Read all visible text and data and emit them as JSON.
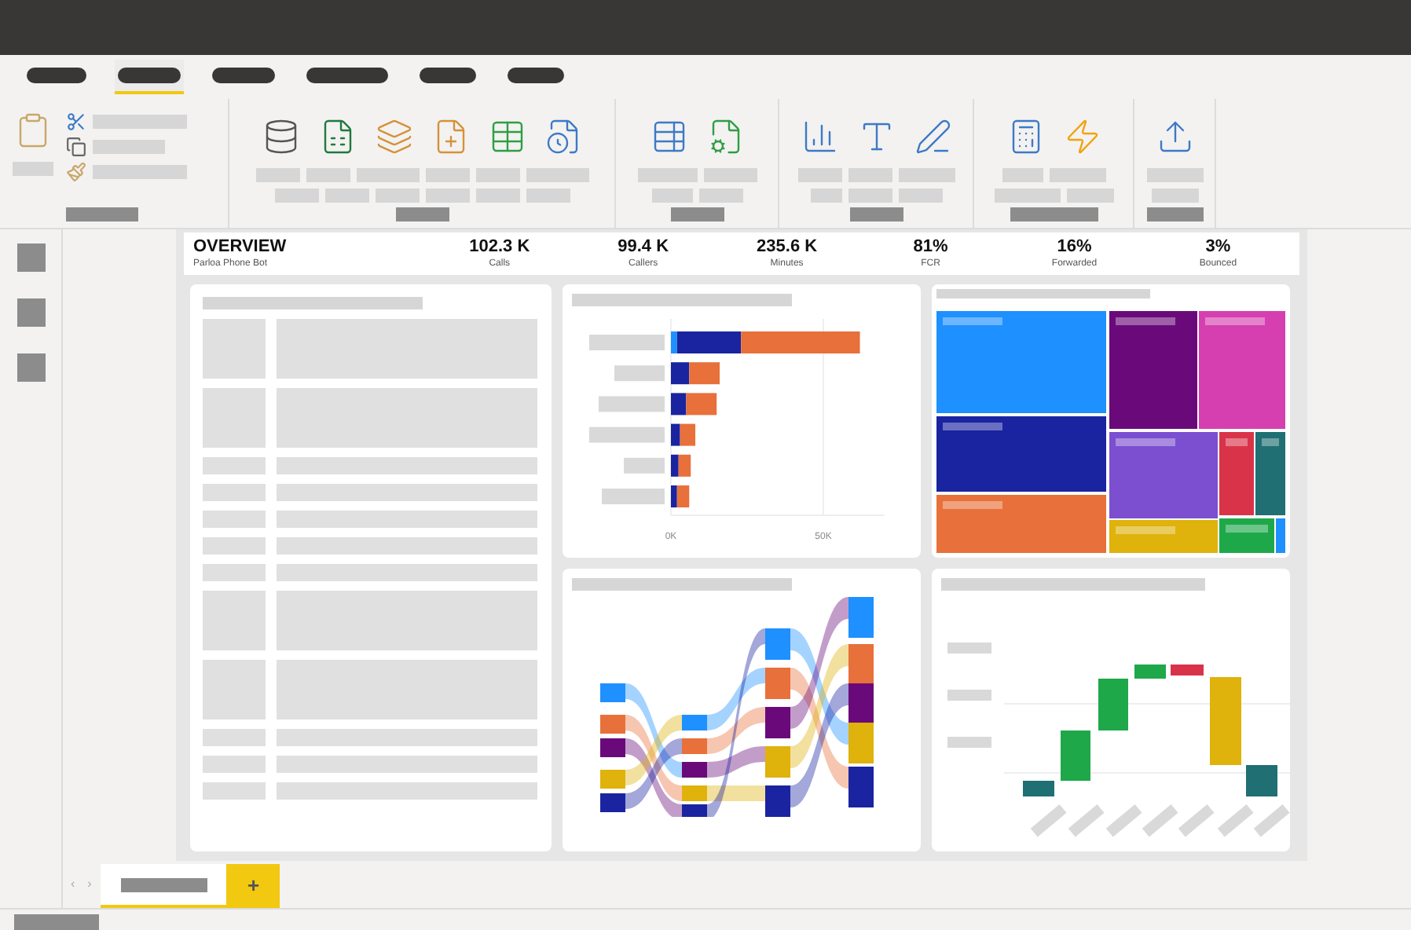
{
  "ribbon_tabs": [
    {
      "selected": false
    },
    {
      "selected": true
    },
    {
      "selected": false
    },
    {
      "selected": false
    },
    {
      "selected": false
    },
    {
      "selected": false
    }
  ],
  "report": {
    "title": "OVERVIEW",
    "subtitle": "Parloa Phone Bot",
    "kpis": [
      {
        "value": "102.3 K",
        "label": "Calls"
      },
      {
        "value": "99.4 K",
        "label": "Callers"
      },
      {
        "value": "235.6 K",
        "label": "Minutes"
      },
      {
        "value": "81%",
        "label": "FCR"
      },
      {
        "value": "16%",
        "label": "Forwarded"
      },
      {
        "value": "3%",
        "label": "Bounced"
      }
    ]
  },
  "bar_chart": {
    "chart_data": {
      "type": "bar",
      "orientation": "horizontal",
      "stacked": true,
      "xlim": [
        0,
        70000
      ],
      "xticks": [
        {
          "value": 0,
          "label": "0K"
        },
        {
          "value": 50000,
          "label": "50K"
        }
      ],
      "series": [
        {
          "color": "#1e90ff",
          "values": [
            2000,
            0,
            0,
            0,
            0,
            0
          ]
        },
        {
          "color": "#1a24a0",
          "values": [
            21000,
            6000,
            5000,
            3000,
            2500,
            2000
          ]
        },
        {
          "color": "#e8703a",
          "values": [
            39000,
            10000,
            10000,
            5000,
            4000,
            4000
          ]
        }
      ]
    }
  },
  "page_tabs": {
    "scroll_buttons": [
      "‹",
      "›"
    ],
    "tabs": [
      {
        "selected": true
      }
    ],
    "add_button": "+"
  }
}
